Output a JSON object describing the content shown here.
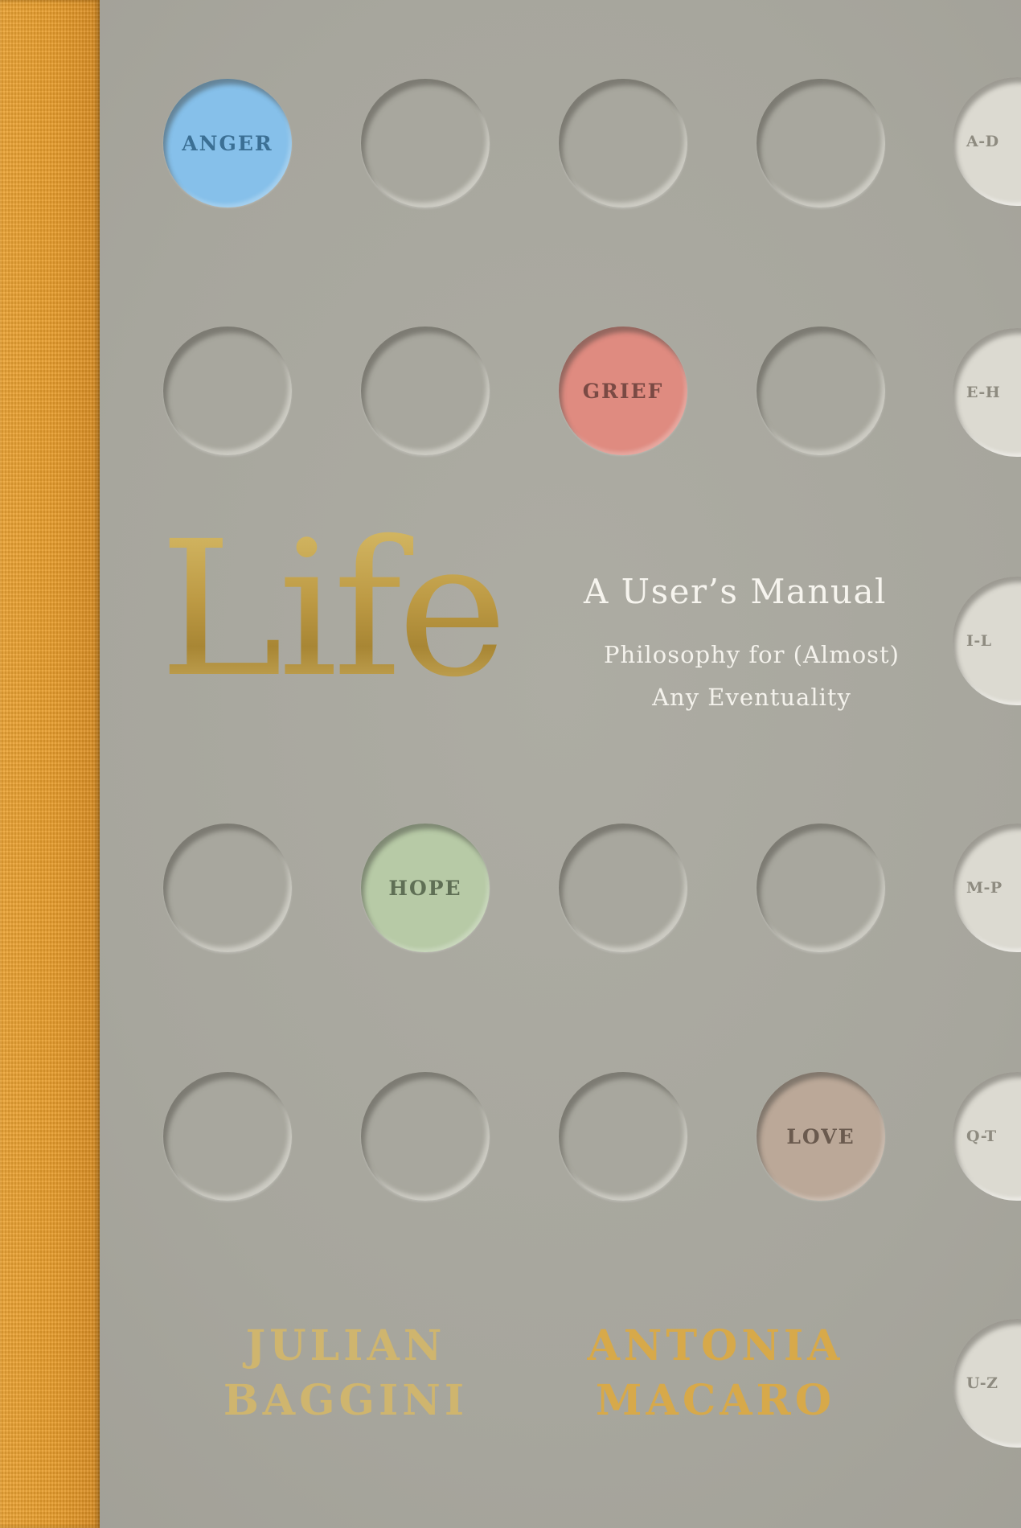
{
  "cover": {
    "title": "Life",
    "subtitle": "A User’s Manual",
    "tagline_line1": "Philosophy for (Almost)",
    "tagline_line2": "Any Eventuality",
    "authors": [
      {
        "first": "JULIAN",
        "last": "BAGGINI"
      },
      {
        "first": "ANTONIA",
        "last": "MACARO"
      }
    ]
  },
  "labeled_circles": [
    {
      "label": "ANGER",
      "color": "#86c0ea",
      "text_color": "#3b6f94"
    },
    {
      "label": "GRIEF",
      "color": "#df8b80",
      "text_color": "#7a4a44"
    },
    {
      "label": "HOPE",
      "color": "#b7caa6",
      "text_color": "#5f6f55"
    },
    {
      "label": "LOVE",
      "color": "#bba898",
      "text_color": "#6a5a4e"
    }
  ],
  "index_tabs": [
    "A-D",
    "E-H",
    "I-L",
    "M-P",
    "Q-T",
    "U-Z"
  ],
  "colors": {
    "background": "#a8a79e",
    "spine": "#e89c2a",
    "gold": "#c2a24a",
    "tab": "#dcdad1"
  }
}
